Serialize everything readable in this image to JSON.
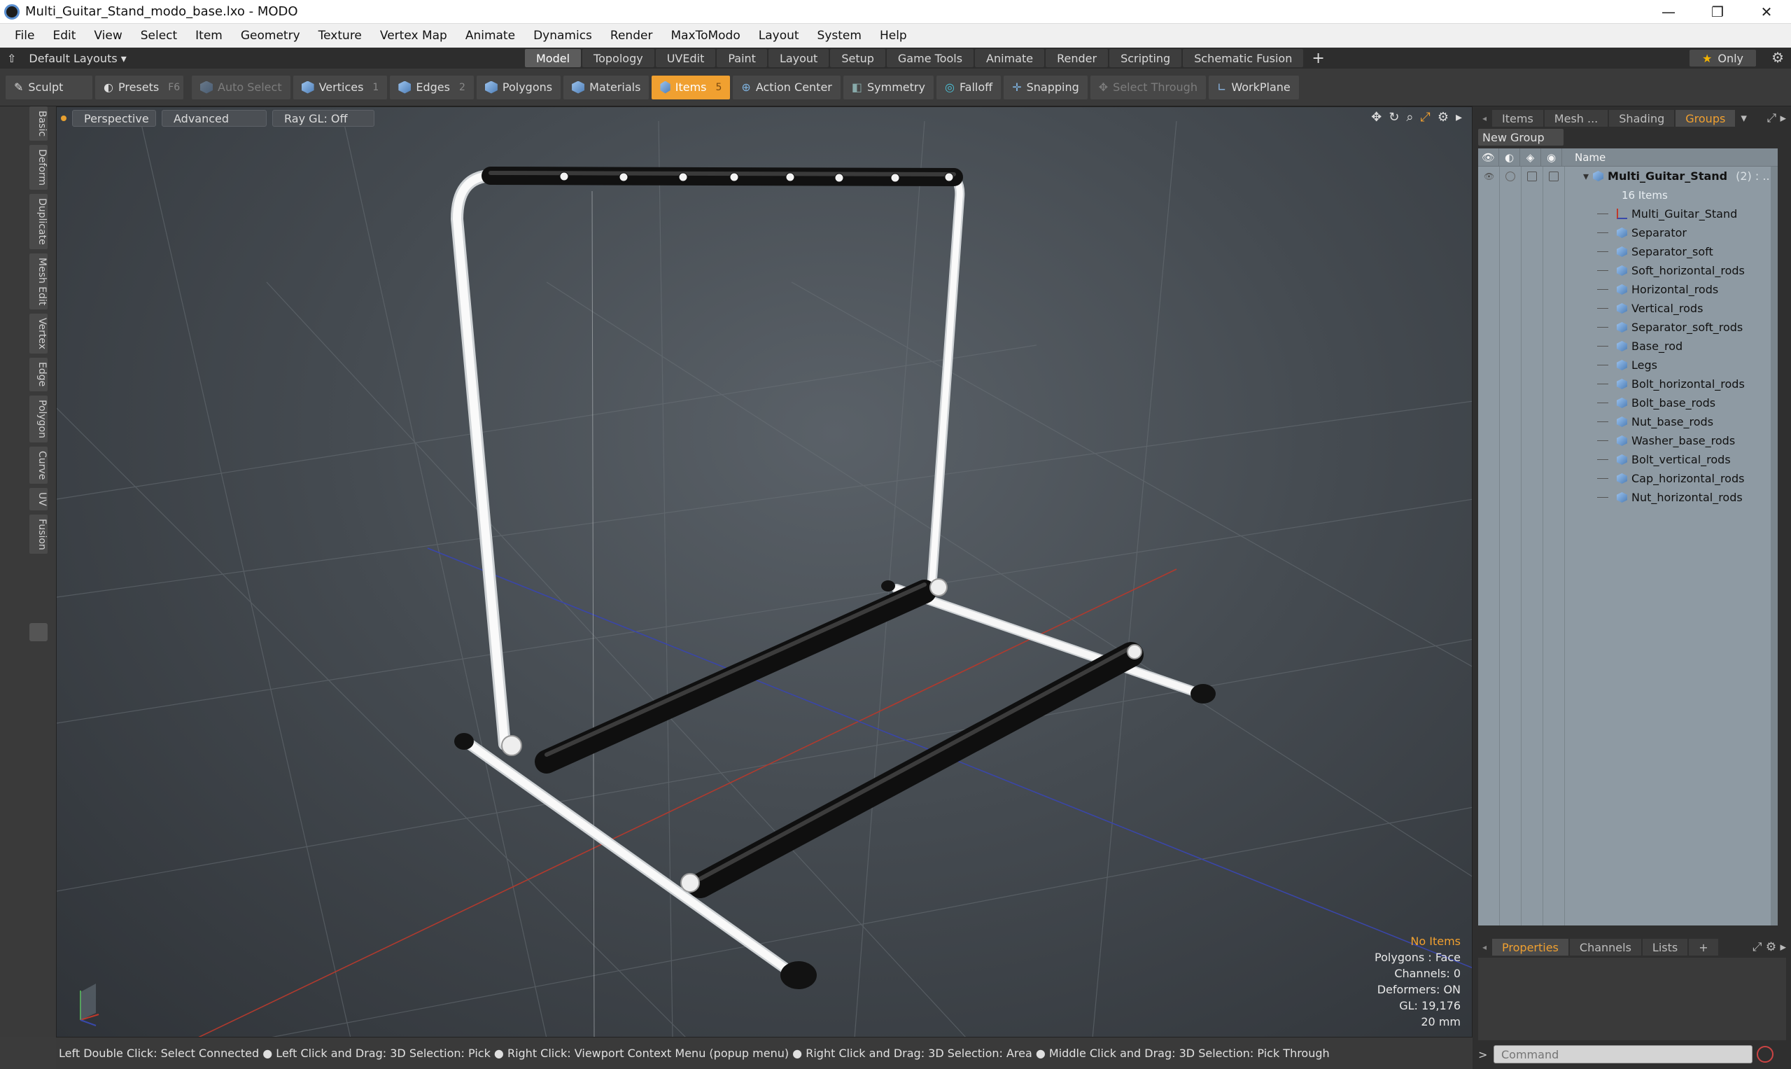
{
  "window": {
    "title": "Multi_Guitar_Stand_modo_base.lxo - MODO",
    "minimize": "—",
    "maximize": "❐",
    "close": "✕"
  },
  "menu": [
    "File",
    "Edit",
    "View",
    "Select",
    "Item",
    "Geometry",
    "Texture",
    "Vertex Map",
    "Animate",
    "Dynamics",
    "Render",
    "MaxToModo",
    "Layout",
    "System",
    "Help"
  ],
  "layout": {
    "selector": "Default Layouts ▾",
    "only": "Only"
  },
  "tabs": [
    {
      "label": "Model",
      "active": true
    },
    {
      "label": "Topology"
    },
    {
      "label": "UVEdit"
    },
    {
      "label": "Paint"
    },
    {
      "label": "Layout"
    },
    {
      "label": "Setup"
    },
    {
      "label": "Game Tools"
    },
    {
      "label": "Animate"
    },
    {
      "label": "Render"
    },
    {
      "label": "Scripting"
    },
    {
      "label": "Schematic Fusion"
    }
  ],
  "toolbar": {
    "sculpt": "Sculpt",
    "presets": "Presets",
    "presets_key": "F6",
    "auto_select": "Auto Select",
    "vertices": "Vertices",
    "vertices_key": "1",
    "edges": "Edges",
    "edges_key": "2",
    "polygons": "Polygons",
    "materials": "Materials",
    "items": "Items",
    "items_key": "5",
    "action_center": "Action Center",
    "symmetry": "Symmetry",
    "falloff": "Falloff",
    "snapping": "Snapping",
    "select_through": "Select Through",
    "workplane": "WorkPlane"
  },
  "left_tabs": [
    "Basic",
    "Deform",
    "Duplicate",
    "Mesh Edit",
    "Vertex",
    "Edge",
    "Polygon",
    "Curve",
    "UV",
    "Fusion"
  ],
  "viewport": {
    "view": "Perspective",
    "advanced": "Advanced",
    "raygl": "Ray GL: Off",
    "info": {
      "selection": "No Items",
      "polygons": "Polygons : Face",
      "channels": "Channels: 0",
      "deformers": "Deformers: ON",
      "gl": "GL: 19,176",
      "grid": "20 mm"
    }
  },
  "status": "Left Double Click: Select Connected ● Left Click and Drag: 3D Selection: Pick ● Right Click: Viewport Context Menu (popup menu) ● Right Click and Drag: 3D Selection: Area ● Middle Click and Drag: 3D Selection: Pick Through",
  "groups_panel": {
    "tabs": [
      "Items",
      "Mesh ...",
      "Shading",
      "Groups"
    ],
    "active_tab": "Groups",
    "new_group": "New Group",
    "name_header": "Name",
    "root": {
      "name": "Multi_Guitar_Stand",
      "count": "(2) : ...",
      "sub": "16 Items"
    },
    "items": [
      "Multi_Guitar_Stand",
      "Separator",
      "Separator_soft",
      "Soft_horizontal_rods",
      "Horizontal_rods",
      "Vertical_rods",
      "Separator_soft_rods",
      "Base_rod",
      "Legs",
      "Bolt_horizontal_rods",
      "Bolt_base_rods",
      "Nut_base_rods",
      "Washer_base_rods",
      "Bolt_vertical_rods",
      "Cap_horizontal_rods",
      "Nut_horizontal_rods"
    ]
  },
  "properties_panel": {
    "tabs": [
      "Properties",
      "Channels",
      "Lists",
      "+"
    ],
    "active_tab": "Properties",
    "command_placeholder": "Command"
  },
  "colors": {
    "accent": "#f0a030",
    "panel_bg": "#8e9aa3",
    "axis_x": "#c0392b",
    "axis_z": "#3949ab"
  }
}
